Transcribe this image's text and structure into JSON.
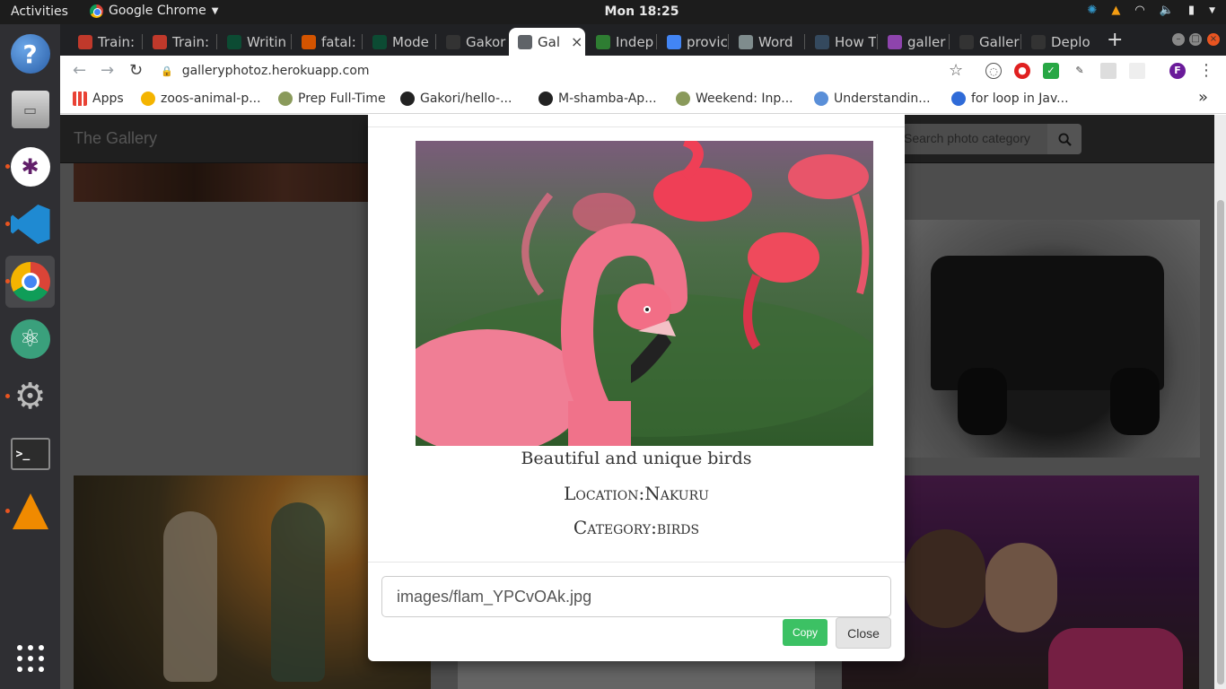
{
  "system": {
    "activities": "Activities",
    "app_name": "Google Chrome",
    "clock": "Mon 18:25"
  },
  "dock": {
    "items": [
      {
        "name": "help-icon"
      },
      {
        "name": "file-manager-icon"
      },
      {
        "name": "slack-icon"
      },
      {
        "name": "vscode-icon"
      },
      {
        "name": "chrome-icon"
      },
      {
        "name": "atom-icon"
      },
      {
        "name": "settings-icon"
      },
      {
        "name": "terminal-icon"
      },
      {
        "name": "vlc-icon"
      },
      {
        "name": "show-apps-icon"
      }
    ]
  },
  "browser": {
    "tabs": [
      {
        "label": "Train:",
        "color": "#c0392b"
      },
      {
        "label": "Train:",
        "color": "#c0392b"
      },
      {
        "label": "Writin",
        "color": "#0c4b33"
      },
      {
        "label": "fatal:",
        "color": "#d35400"
      },
      {
        "label": "Mode",
        "color": "#0c4b33"
      },
      {
        "label": "Gakor",
        "color": "#333333"
      },
      {
        "label": "Gal",
        "color": "#5f6368"
      },
      {
        "label": "Indep",
        "color": "#2e7d32"
      },
      {
        "label": "provic",
        "color": "#4285f4"
      },
      {
        "label": "Word",
        "color": "#7f8c8d"
      },
      {
        "label": "How T",
        "color": "#34495e"
      },
      {
        "label": "galler",
        "color": "#8e44ad"
      },
      {
        "label": "Galler",
        "color": "#333333"
      },
      {
        "label": "Deplo",
        "color": "#333333"
      }
    ],
    "url": "galleryphotoz.herokuapp.com",
    "profile_initial": "F",
    "bookmarks": [
      {
        "label": "Apps"
      },
      {
        "label": "zoos-animal-p..."
      },
      {
        "label": "Prep Full-Time"
      },
      {
        "label": "Gakori/hello-..."
      },
      {
        "label": "M-shamba-Ap..."
      },
      {
        "label": "Weekend: Inp..."
      },
      {
        "label": "Understandin..."
      },
      {
        "label": "for loop in Jav..."
      }
    ],
    "overflow": "»"
  },
  "page": {
    "brand": "The Gallery",
    "search_placeholder": "Search photo category"
  },
  "modal": {
    "description": "Beautiful and unique birds",
    "location": "Location:Nakuru",
    "category": "Category:birds",
    "image_path": "images/flam_YPCvOAk.jpg",
    "copy_label": "Copy",
    "close_label": "Close"
  }
}
